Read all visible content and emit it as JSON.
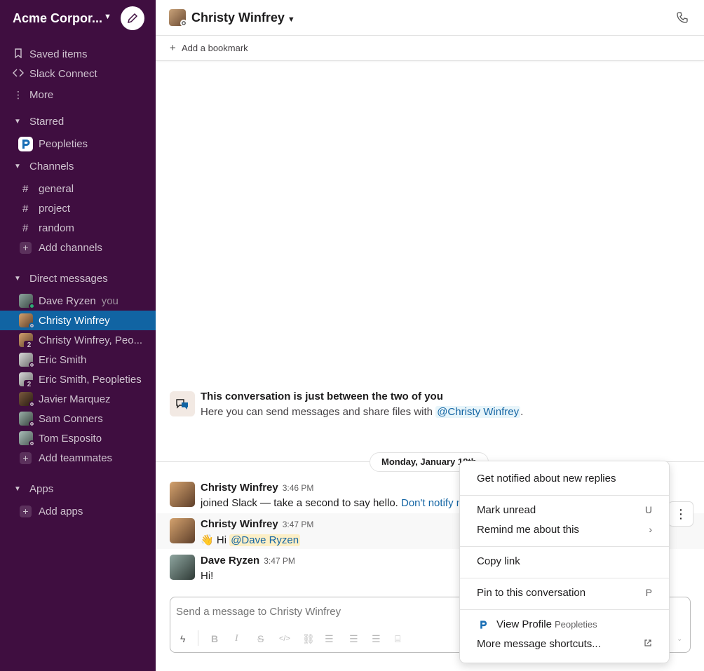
{
  "workspace": {
    "name": "Acme Corpor...",
    "compose_icon": "compose-icon"
  },
  "sidebar": {
    "nav": [
      {
        "label": "Saved items",
        "icon": "bookmark-icon"
      },
      {
        "label": "Slack Connect",
        "icon": "slack-connect-icon"
      },
      {
        "label": "More",
        "icon": "more-vertical-icon"
      }
    ],
    "starred": {
      "label": "Starred",
      "items": [
        {
          "label": "Peopleties"
        }
      ]
    },
    "channels": {
      "label": "Channels",
      "items": [
        "general",
        "project",
        "random"
      ],
      "add_label": "Add channels"
    },
    "direct_messages": {
      "label": "Direct messages",
      "items": [
        {
          "label": "Dave Ryzen",
          "suffix": "you"
        },
        {
          "label": "Christy Winfrey"
        },
        {
          "label": "Christy Winfrey, Peo...",
          "count": "2"
        },
        {
          "label": "Eric Smith"
        },
        {
          "label": "Eric Smith, Peopleties",
          "count": "2"
        },
        {
          "label": "Javier Marquez"
        },
        {
          "label": "Sam Conners"
        },
        {
          "label": "Tom Esposito"
        }
      ],
      "add_label": "Add teammates"
    },
    "apps": {
      "label": "Apps",
      "add_label": "Add apps"
    }
  },
  "header": {
    "title": "Christy Winfrey",
    "bookmark_label": "Add a bookmark"
  },
  "intro": {
    "title": "This conversation is just between the two of you",
    "text_before": "Here you can send messages and share files with ",
    "mention": "@Christy Winfrey",
    "text_after": "."
  },
  "date_divider": "Monday, January 18th",
  "messages": [
    {
      "author": "Christy Winfrey",
      "time": "3:46 PM",
      "text": "joined Slack — take a second to say hello. ",
      "link": "Don't notify m"
    },
    {
      "author": "Christy Winfrey",
      "time": "3:47 PM",
      "emoji": "👋",
      "text": " Hi ",
      "mention": "@Dave Ryzen"
    },
    {
      "author": "Dave Ryzen",
      "time": "3:47 PM",
      "text": "Hi!"
    }
  ],
  "composer": {
    "placeholder": "Send a message to Christy Winfrey"
  },
  "context_menu": {
    "get_notified": "Get notified about new replies",
    "mark_unread": "Mark unread",
    "mark_unread_key": "U",
    "remind": "Remind me about this",
    "remind_key": "›",
    "copy_link": "Copy link",
    "pin": "Pin to this conversation",
    "pin_key": "P",
    "view_profile": "View Profile",
    "view_profile_app": "Peopleties",
    "more_shortcuts": "More message shortcuts..."
  },
  "colors": {
    "sidebar_bg": "#3f0e40",
    "active": "#1164a3",
    "link": "#1264a3",
    "online": "#2bac76"
  }
}
